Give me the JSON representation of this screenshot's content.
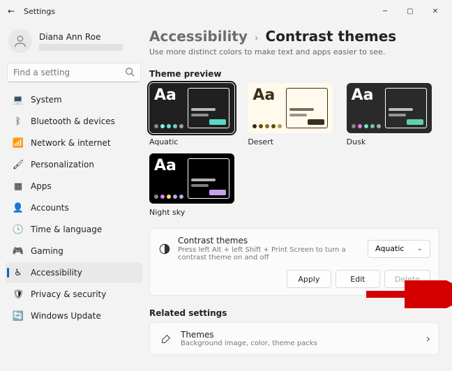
{
  "window": {
    "title": "Settings"
  },
  "profile": {
    "name": "Diana Ann Roe"
  },
  "search": {
    "placeholder": "Find a setting"
  },
  "nav": {
    "items": [
      {
        "label": "System",
        "icon": "💻",
        "key": "system"
      },
      {
        "label": "Bluetooth & devices",
        "icon": "ᛒ",
        "key": "bluetooth"
      },
      {
        "label": "Network & internet",
        "icon": "📶",
        "key": "network"
      },
      {
        "label": "Personalization",
        "icon": "🖌",
        "key": "personalization"
      },
      {
        "label": "Apps",
        "icon": "▦",
        "key": "apps"
      },
      {
        "label": "Accounts",
        "icon": "👤",
        "key": "accounts"
      },
      {
        "label": "Time & language",
        "icon": "🕓",
        "key": "time"
      },
      {
        "label": "Gaming",
        "icon": "🎮",
        "key": "gaming"
      },
      {
        "label": "Accessibility",
        "icon": "♿",
        "key": "accessibility"
      },
      {
        "label": "Privacy & security",
        "icon": "🛡",
        "key": "privacy"
      },
      {
        "label": "Windows Update",
        "icon": "🔄",
        "key": "update"
      }
    ],
    "active": "accessibility"
  },
  "breadcrumb": {
    "parent": "Accessibility",
    "current": "Contrast themes"
  },
  "subtitle": "Use more distinct colors to make text and apps easier to see.",
  "sectionPreview": "Theme preview",
  "themes": [
    {
      "name": "Aquatic",
      "bg": "#202020",
      "fg": "#ffffff",
      "dots": [
        "#8a8a8a",
        "#8aeaff",
        "#6de2d0",
        "#5fd8c6",
        "#a0a0a0"
      ],
      "border": "#ffffff",
      "bar": "#58d8c8"
    },
    {
      "name": "Desert",
      "bg": "#fffaec",
      "fg": "#3a301a",
      "dots": [
        "#2b2b2b",
        "#6b4d00",
        "#8a6a20",
        "#5a4a10",
        "#b29a50"
      ],
      "border": "#3a301a",
      "bar": "#3a301a"
    },
    {
      "name": "Dusk",
      "bg": "#2a2a2a",
      "fg": "#ffffff",
      "dots": [
        "#888",
        "#e080e0",
        "#7de0c0",
        "#60d0b0",
        "#aaa"
      ],
      "border": "#ffffff",
      "bar": "#60d0b0"
    },
    {
      "name": "Night sky",
      "bg": "#000000",
      "fg": "#ffffff",
      "dots": [
        "#888",
        "#e080f0",
        "#f0e080",
        "#c8a0f0",
        "#b0b0f0"
      ],
      "border": "#ffffff",
      "bar": "#c8a0f0"
    }
  ],
  "selectedThemeIndex": 0,
  "card": {
    "title": "Contrast themes",
    "sub": "Press left Alt + left Shift + Print Screen to turn a contrast theme on and off",
    "dropdownValue": "Aquatic",
    "apply": "Apply",
    "edit": "Edit",
    "delete": "Delete"
  },
  "related": {
    "heading": "Related settings",
    "item": {
      "title": "Themes",
      "sub": "Background image, color, theme packs"
    }
  }
}
